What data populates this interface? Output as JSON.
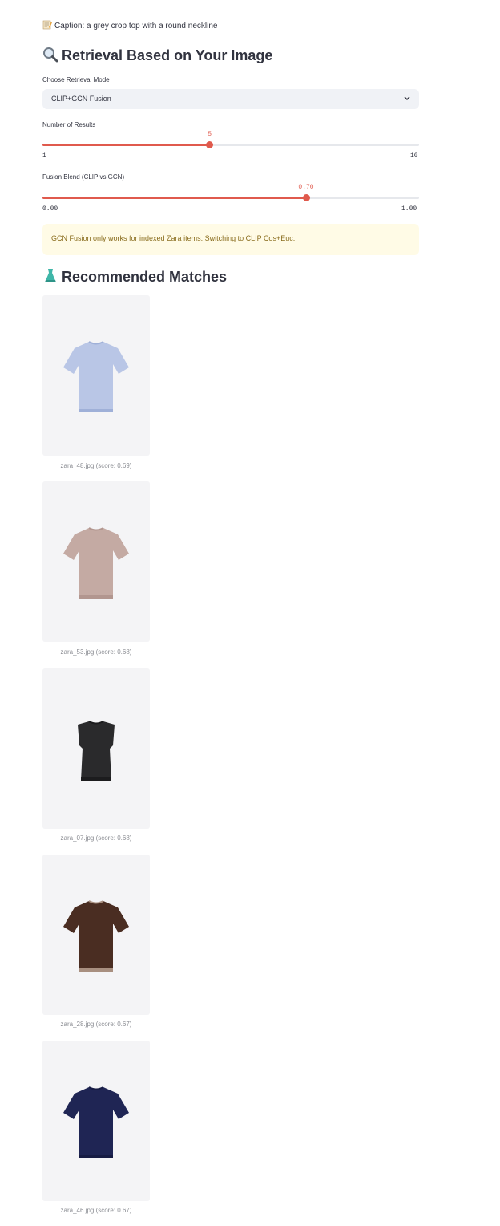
{
  "caption": {
    "text": "Caption: a grey crop top with a round neckline",
    "icon": "memo-icon"
  },
  "retrieval": {
    "heading": "Retrieval Based on Your Image",
    "icon": "magnifier-icon",
    "mode_label": "Choose Retrieval Mode",
    "mode_value": "CLIP+GCN Fusion",
    "num_results": {
      "label": "Number of Results",
      "value": "5",
      "min": "1",
      "max": "10",
      "fraction": 0.444
    },
    "fusion_blend": {
      "label": "Fusion Blend (CLIP vs GCN)",
      "value": "0.70",
      "min": "0.00",
      "max": "1.00",
      "fraction": 0.7
    },
    "warning": "GCN Fusion only works for indexed Zara items. Switching to CLIP Cos+Euc."
  },
  "matches": {
    "heading": "Recommended Matches",
    "icon": "dress-icon",
    "items": [
      {
        "caption": "zara_48.jpg (score: 0.69)",
        "color": "#b9c6e6",
        "trim": "#9fb0d8",
        "style": "tee"
      },
      {
        "caption": "zara_53.jpg (score: 0.68)",
        "color": "#c4aaa3",
        "trim": "#b2968f",
        "style": "tee"
      },
      {
        "caption": "zara_07.jpg (score: 0.68)",
        "color": "#2a2a2c",
        "trim": "#1c1c1e",
        "style": "sleeveless"
      },
      {
        "caption": "zara_28.jpg (score: 0.67)",
        "color": "#4a2d22",
        "trim": "#a88f80",
        "style": "tee"
      },
      {
        "caption": "zara_46.jpg (score: 0.67)",
        "color": "#1f2554",
        "trim": "#171c44",
        "style": "tee"
      }
    ]
  },
  "colors": {
    "accent": "#e05a4d",
    "warning_bg": "#fffbe6",
    "warning_text": "#8a6d1e"
  }
}
